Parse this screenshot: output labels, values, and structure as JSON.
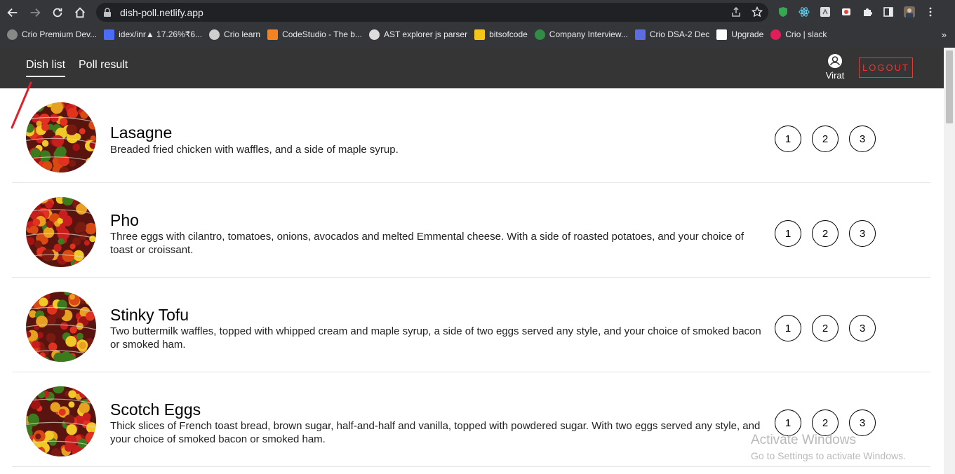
{
  "browser": {
    "url": "dish-poll.netlify.app",
    "bookmarks": [
      {
        "label": "Crio Premium Dev...",
        "color": "#888888"
      },
      {
        "label": "idex/inr▲ 17.26%₹6...",
        "color": "#4a6cf7"
      },
      {
        "label": "Crio learn",
        "color": "#cfcfcf"
      },
      {
        "label": "CodeStudio - The b...",
        "color": "#f58220"
      },
      {
        "label": "AST explorer js parser",
        "color": "#dddddd"
      },
      {
        "label": "bitsofcode",
        "color": "#f5c518"
      },
      {
        "label": "Company Interview...",
        "color": "#2f8d46"
      },
      {
        "label": "Crio DSA-2 Dec",
        "color": "#5b6ee1"
      },
      {
        "label": "Upgrade",
        "color": "#ffffff"
      },
      {
        "label": "Crio | slack",
        "color": "#e01e5a"
      }
    ],
    "more": "»"
  },
  "header": {
    "tabs": [
      {
        "label": "Dish list",
        "active": true
      },
      {
        "label": "Poll result",
        "active": false
      }
    ],
    "user": {
      "name": "Virat",
      "icon": "user-icon"
    },
    "logout": "LOGOUT",
    "accent": "#e53935",
    "bg": "#353535"
  },
  "dishes": [
    {
      "name": "Lasagne",
      "description": "Breaded fried chicken with waffles, and a side of maple syrup.",
      "ranks": [
        "1",
        "2",
        "3"
      ]
    },
    {
      "name": "Pho",
      "description": "Three eggs with cilantro, tomatoes, onions, avocados and melted Emmental cheese. With a side of roasted potatoes, and your choice of toast or croissant.",
      "ranks": [
        "1",
        "2",
        "3"
      ]
    },
    {
      "name": "Stinky Tofu",
      "description": "Two buttermilk waffles, topped with whipped cream and maple syrup, a side of two eggs served any style, and your choice of smoked bacon or smoked ham.",
      "ranks": [
        "1",
        "2",
        "3"
      ]
    },
    {
      "name": "Scotch Eggs",
      "description": "Thick slices of French toast bread, brown sugar, half-and-half and vanilla, topped with powdered sugar. With two eggs served any style, and your choice of smoked bacon or smoked ham.",
      "ranks": [
        "1",
        "2",
        "3"
      ]
    }
  ],
  "watermark": {
    "title": "Activate Windows",
    "subtitle": "Go to Settings to activate Windows."
  }
}
